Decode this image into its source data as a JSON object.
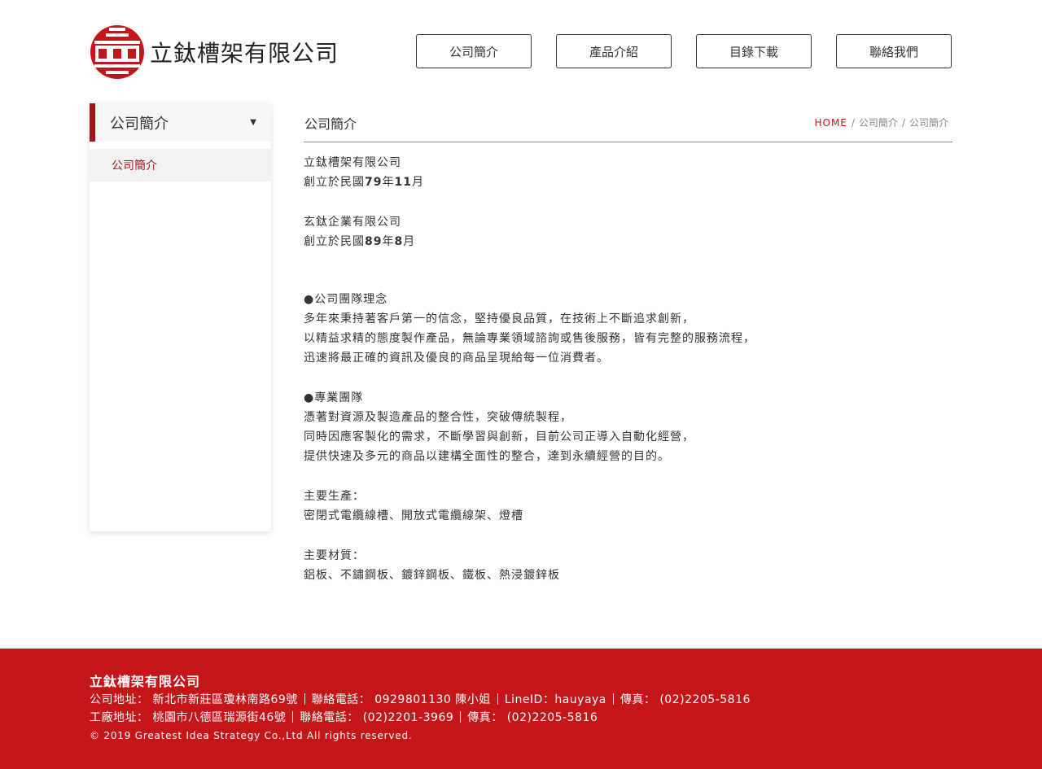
{
  "header": {
    "company_name": "立鈦槽架有限公司",
    "nav": [
      "公司簡介",
      "產品介紹",
      "目錄下載",
      "聯絡我們"
    ]
  },
  "sidebar": {
    "title": "公司簡介",
    "items": [
      "公司簡介"
    ]
  },
  "main": {
    "title": "公司簡介",
    "breadcrumb": [
      "HOME",
      "公司簡介",
      "公司簡介"
    ],
    "blocks": {
      "co1_name": "立鈦槽架有限公司",
      "co1_founded_prefix": "創立於民國",
      "co1_year": "79",
      "co1_year_unit": "年",
      "co1_month": "11",
      "co1_month_unit": "月",
      "co2_name": "玄鈦企業有限公司",
      "co2_founded_prefix": "創立於民國",
      "co2_year": "89",
      "co2_year_unit": "年",
      "co2_month": "8",
      "co2_month_unit": "月",
      "philosophy_title": "●公司團隊理念",
      "philosophy_lines": [
        "多年來秉持著客戶第一的信念，堅持優良品質，在技術上不斷追求創新，",
        "以精益求精的態度製作產品，無論專業領域諮詢或售後服務，皆有完整的服務流程，",
        "迅速將最正確的資訊及優良的商品呈現給每一位消費者。"
      ],
      "team_title": "●專業團隊",
      "team_lines": [
        "憑著對資源及製造產品的整合性，突破傳統製程，",
        "同時因應客製化的需求，不斷學習與創新，目前公司正導入自動化經營，",
        "提供快速及多元的商品以建構全面性的整合，達到永續經營的目的。"
      ],
      "products_title": "主要生產：",
      "products_text": "密閉式電纜線槽、開放式電纜線架、燈槽",
      "materials_title": "主要材質：",
      "materials_text": "鋁板、不鏽鋼板、鍍鋅鋼板、鐵板、熱浸鍍鋅板"
    }
  },
  "footer": {
    "company": "立鈦槽架有限公司",
    "line1": {
      "address": "公司地址： 新北市新莊區瓊林南路69號",
      "phone": "聯絡電話： 0929801130 陳小姐",
      "lineid": "LineID：hauyaya",
      "fax": "傳真： (02)2205-5816"
    },
    "line2": {
      "address": "工廠地址： 桃園市八德區瑞源街46號",
      "phone": "聯絡電話： (02)2201-3969",
      "fax": "傳真： (02)2205-5816"
    },
    "copyright": "© 2019 Greatest Idea Strategy Co.,Ltd All rights reserved."
  },
  "colors": {
    "brand_red": "#c41518",
    "accent_dark_red": "#a0161a"
  }
}
